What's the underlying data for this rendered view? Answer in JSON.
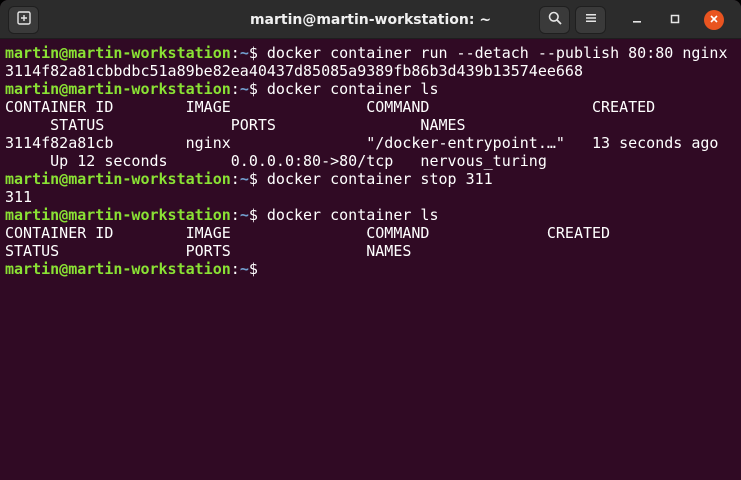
{
  "window": {
    "title": "martin@martin-workstation: ~",
    "controls": {
      "new_tab_icon": "new-tab-icon",
      "search_icon": "search-icon",
      "menu_icon": "hamburger-menu-icon",
      "minimize_icon": "minimize-icon",
      "maximize_icon": "maximize-icon",
      "close_icon": "close-icon"
    }
  },
  "colors": {
    "terminal_bg": "#300a24",
    "prompt_user": "#8ae234",
    "prompt_path": "#729fcf",
    "close_button": "#e95420",
    "titlebar_bg": "#2c2c2c"
  },
  "terminal": {
    "prompt": {
      "user_host": "martin@martin-workstation",
      "separator": ":",
      "path": "~",
      "symbol": "$ "
    },
    "lines": [
      {
        "type": "command",
        "text": "docker container run --detach --publish 80:80 nginx"
      },
      {
        "type": "output",
        "text": "3114f82a81cbbdbc51a89be82ea40437d85085a9389fb86b3d439b13574ee668"
      },
      {
        "type": "command",
        "text": "docker container ls"
      },
      {
        "type": "output",
        "text": "CONTAINER ID        IMAGE               COMMAND                  CREATED"
      },
      {
        "type": "output",
        "text": "     STATUS              PORTS                NAMES"
      },
      {
        "type": "output",
        "text": "3114f82a81cb        nginx               \"/docker-entrypoint.…\"   13 seconds ago"
      },
      {
        "type": "output",
        "text": "     Up 12 seconds       0.0.0.0:80->80/tcp   nervous_turing"
      },
      {
        "type": "command",
        "text": "docker container stop 311"
      },
      {
        "type": "output",
        "text": "311"
      },
      {
        "type": "command",
        "text": "docker container ls"
      },
      {
        "type": "output",
        "text": "CONTAINER ID        IMAGE               COMMAND             CREATED"
      },
      {
        "type": "output",
        "text": "STATUS              PORTS               NAMES"
      },
      {
        "type": "command",
        "text": ""
      }
    ]
  }
}
